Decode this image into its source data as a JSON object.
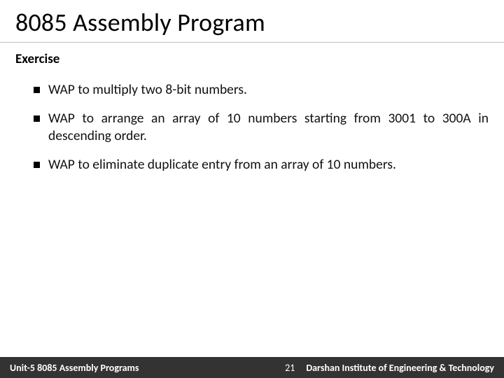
{
  "title": "8085 Assembly Program",
  "subhead": "Exercise",
  "bullets": [
    "WAP to multiply two 8-bit numbers.",
    "WAP to arrange an array of 10 numbers starting from 3001 to 300A in descending order.",
    "WAP to eliminate duplicate entry from an array of 10 numbers."
  ],
  "footer": {
    "unit": "Unit-5 8085 Assembly Programs",
    "page": "21",
    "institution": "Darshan Institute of Engineering & Technology"
  }
}
